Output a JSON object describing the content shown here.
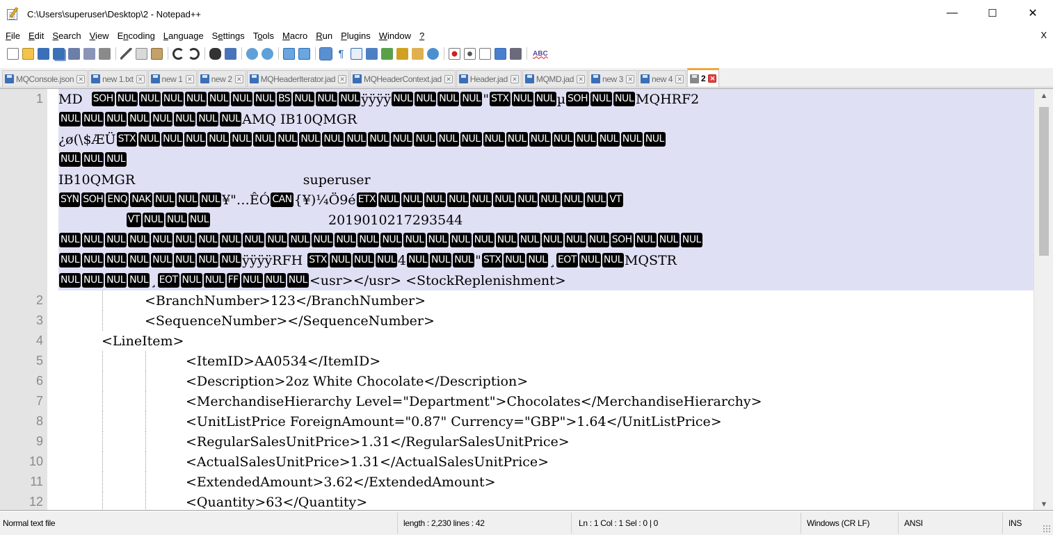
{
  "window": {
    "title": "C:\\Users\\superuser\\Desktop\\2 - Notepad++",
    "minimize": "—",
    "maximize": "☐",
    "close": "✕"
  },
  "menu": {
    "items": [
      "File",
      "Edit",
      "Search",
      "View",
      "Encoding",
      "Language",
      "Settings",
      "Tools",
      "Macro",
      "Run",
      "Plugins",
      "Window",
      "?"
    ],
    "close_doc": "X"
  },
  "toolbar": {
    "spellcheck_label": "ABC"
  },
  "tabs": [
    {
      "label": "MQConsole.json",
      "active": false
    },
    {
      "label": "new 1.txt",
      "active": false
    },
    {
      "label": "new 1",
      "active": false
    },
    {
      "label": "new 2",
      "active": false
    },
    {
      "label": "MQHeaderIterator.jad",
      "active": false
    },
    {
      "label": "MQHeaderContext.jad",
      "active": false
    },
    {
      "label": "Header.jad",
      "active": false
    },
    {
      "label": "MQMD.jad",
      "active": false
    },
    {
      "label": "new 3",
      "active": false
    },
    {
      "label": "new 4",
      "active": false
    },
    {
      "label": "2",
      "active": true
    }
  ],
  "editor": {
    "line1_number": "1",
    "wrapped_rows": [
      [
        {
          "t": "MD  "
        },
        {
          "c": "SOH"
        },
        {
          "c": "NUL"
        },
        {
          "c": "NUL"
        },
        {
          "c": "NUL"
        },
        {
          "c": "NUL"
        },
        {
          "c": "NUL"
        },
        {
          "c": "NUL"
        },
        {
          "c": "NUL"
        },
        {
          "c": "BS"
        },
        {
          "c": "NUL"
        },
        {
          "c": "NUL"
        },
        {
          "c": "NUL"
        },
        {
          "t": "ÿÿÿÿ"
        },
        {
          "c": "NUL"
        },
        {
          "c": "NUL"
        },
        {
          "c": "NUL"
        },
        {
          "c": "NUL"
        },
        {
          "t": "\""
        },
        {
          "c": "STX"
        },
        {
          "c": "NUL"
        },
        {
          "c": "NUL"
        },
        {
          "t": "µ"
        },
        {
          "c": "SOH"
        },
        {
          "c": "NUL"
        },
        {
          "c": "NUL"
        },
        {
          "t": "MQHRF2"
        }
      ],
      [
        {
          "c": "NUL"
        },
        {
          "c": "NUL"
        },
        {
          "c": "NUL"
        },
        {
          "c": "NUL"
        },
        {
          "c": "NUL"
        },
        {
          "c": "NUL"
        },
        {
          "c": "NUL"
        },
        {
          "c": "NUL"
        },
        {
          "t": "AMQ IB10QMGR"
        }
      ],
      [
        {
          "t": "¿ø(\\$ÆÜ"
        },
        {
          "c": "STX"
        },
        {
          "c": "NUL"
        },
        {
          "c": "NUL"
        },
        {
          "c": "NUL"
        },
        {
          "c": "NUL"
        },
        {
          "c": "NUL"
        },
        {
          "c": "NUL"
        },
        {
          "c": "NUL"
        },
        {
          "c": "NUL"
        },
        {
          "c": "NUL"
        },
        {
          "c": "NUL"
        },
        {
          "c": "NUL"
        },
        {
          "c": "NUL"
        },
        {
          "c": "NUL"
        },
        {
          "c": "NUL"
        },
        {
          "c": "NUL"
        },
        {
          "c": "NUL"
        },
        {
          "c": "NUL"
        },
        {
          "c": "NUL"
        },
        {
          "c": "NUL"
        },
        {
          "c": "NUL"
        },
        {
          "c": "NUL"
        },
        {
          "c": "NUL"
        },
        {
          "c": "NUL"
        }
      ],
      [
        {
          "c": "NUL"
        },
        {
          "c": "NUL"
        },
        {
          "c": "NUL"
        }
      ],
      [
        {
          "t": "IB10QMGR                                        superuser"
        }
      ],
      [
        {
          "c": "SYN"
        },
        {
          "c": "SOH"
        },
        {
          "c": "ENQ"
        },
        {
          "c": "NAK"
        },
        {
          "c": "NUL"
        },
        {
          "c": "NUL"
        },
        {
          "c": "NUL"
        },
        {
          "t": "¥\"…ÊÓ"
        },
        {
          "c": "CAN"
        },
        {
          "t": "{¥)¼Ö9é"
        },
        {
          "c": "ETX"
        },
        {
          "c": "NUL"
        },
        {
          "c": "NUL"
        },
        {
          "c": "NUL"
        },
        {
          "c": "NUL"
        },
        {
          "c": "NUL"
        },
        {
          "c": "NUL"
        },
        {
          "c": "NUL"
        },
        {
          "c": "NUL"
        },
        {
          "c": "NUL"
        },
        {
          "c": "NUL"
        },
        {
          "c": "VT"
        }
      ],
      [
        {
          "t": "                "
        },
        {
          "c": "VT"
        },
        {
          "c": "NUL"
        },
        {
          "c": "NUL"
        },
        {
          "c": "NUL"
        },
        {
          "t": "                            2019010217293544"
        }
      ],
      [
        {
          "c": "NUL"
        },
        {
          "c": "NUL"
        },
        {
          "c": "NUL"
        },
        {
          "c": "NUL"
        },
        {
          "c": "NUL"
        },
        {
          "c": "NUL"
        },
        {
          "c": "NUL"
        },
        {
          "c": "NUL"
        },
        {
          "c": "NUL"
        },
        {
          "c": "NUL"
        },
        {
          "c": "NUL"
        },
        {
          "c": "NUL"
        },
        {
          "c": "NUL"
        },
        {
          "c": "NUL"
        },
        {
          "c": "NUL"
        },
        {
          "c": "NUL"
        },
        {
          "c": "NUL"
        },
        {
          "c": "NUL"
        },
        {
          "c": "NUL"
        },
        {
          "c": "NUL"
        },
        {
          "c": "NUL"
        },
        {
          "c": "NUL"
        },
        {
          "c": "NUL"
        },
        {
          "c": "NUL"
        },
        {
          "c": "SOH"
        },
        {
          "c": "NUL"
        },
        {
          "c": "NUL"
        },
        {
          "c": "NUL"
        }
      ],
      [
        {
          "c": "NUL"
        },
        {
          "c": "NUL"
        },
        {
          "c": "NUL"
        },
        {
          "c": "NUL"
        },
        {
          "c": "NUL"
        },
        {
          "c": "NUL"
        },
        {
          "c": "NUL"
        },
        {
          "c": "NUL"
        },
        {
          "t": "ÿÿÿÿRFH "
        },
        {
          "c": "STX"
        },
        {
          "c": "NUL"
        },
        {
          "c": "NUL"
        },
        {
          "c": "NUL"
        },
        {
          "t": "4"
        },
        {
          "c": "NUL"
        },
        {
          "c": "NUL"
        },
        {
          "c": "NUL"
        },
        {
          "t": "\""
        },
        {
          "c": "STX"
        },
        {
          "c": "NUL"
        },
        {
          "c": "NUL"
        },
        {
          "t": "¸"
        },
        {
          "c": "EOT"
        },
        {
          "c": "NUL"
        },
        {
          "c": "NUL"
        },
        {
          "t": "MQSTR"
        }
      ],
      [
        {
          "c": "NUL"
        },
        {
          "c": "NUL"
        },
        {
          "c": "NUL"
        },
        {
          "c": "NUL"
        },
        {
          "t": "¸"
        },
        {
          "c": "EOT"
        },
        {
          "c": "NUL"
        },
        {
          "c": "NUL"
        },
        {
          "c": "FF"
        },
        {
          "c": "NUL"
        },
        {
          "c": "NUL"
        },
        {
          "c": "NUL"
        },
        {
          "t": "<usr></usr> <StockReplenishment>"
        }
      ]
    ],
    "lines": [
      {
        "n": "2",
        "text": "<BranchNumber>123</BranchNumber>",
        "indent": 2
      },
      {
        "n": "3",
        "text": "<SequenceNumber></SequenceNumber>",
        "indent": 2
      },
      {
        "n": "4",
        "text": "<LineItem>",
        "indent": 1
      },
      {
        "n": "5",
        "text": "<ItemID>AA0534</ItemID>",
        "indent": 3
      },
      {
        "n": "6",
        "text": "<Description>2oz White Chocolate</Description>",
        "indent": 3
      },
      {
        "n": "7",
        "text": "<MerchandiseHierarchy Level=\"Department\">Chocolates</MerchandiseHierarchy>",
        "indent": 3
      },
      {
        "n": "8",
        "text": "<UnitListPrice ForeignAmount=\"0.87\" Currency=\"GBP\">1.64</UnitListPrice>",
        "indent": 3
      },
      {
        "n": "9",
        "text": "<RegularSalesUnitPrice>1.31</RegularSalesUnitPrice>",
        "indent": 3
      },
      {
        "n": "10",
        "text": "<ActualSalesUnitPrice>1.31</ActualSalesUnitPrice>",
        "indent": 3
      },
      {
        "n": "11",
        "text": "<ExtendedAmount>3.62</ExtendedAmount>",
        "indent": 3
      },
      {
        "n": "12",
        "text": "<Quantity>63</Quantity>",
        "indent": 3
      }
    ]
  },
  "statusbar": {
    "file_type": "Normal text file",
    "length_lines": "length : 2,230    lines : 42",
    "position": "Ln : 1    Col : 1    Sel : 0 | 0",
    "eol": "Windows (CR LF)",
    "encoding": "ANSI",
    "mode": "INS"
  },
  "colors": {
    "selection": "#e0e0f5",
    "gutter": "#e4e4e4",
    "active_tab_accent": "#f5a43a",
    "control_char_bg": "#000000"
  }
}
